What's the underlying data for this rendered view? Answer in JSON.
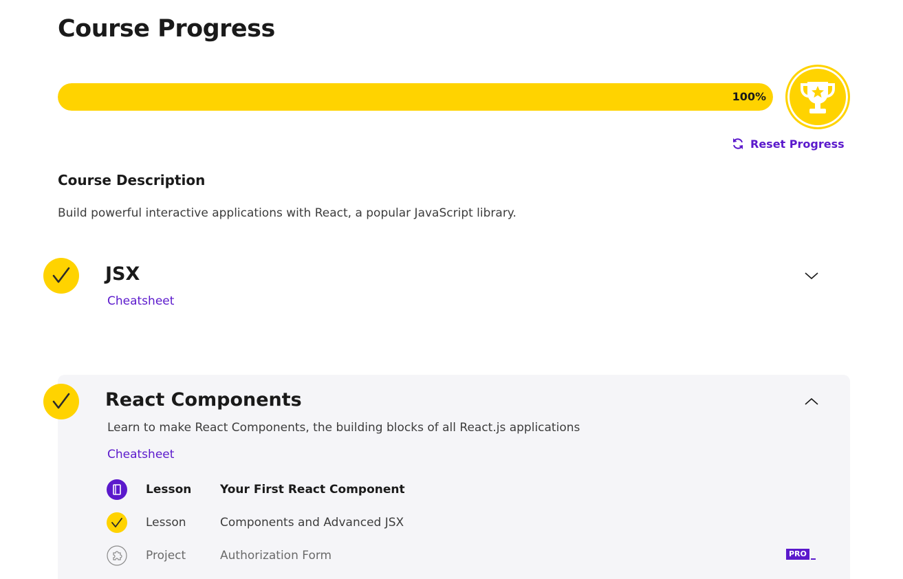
{
  "header": {
    "title": "Course Progress"
  },
  "progress": {
    "percent": 100,
    "label": "100%"
  },
  "colors": {
    "accent": "#ffd300",
    "link": "#5b19cc",
    "panel": "#f5f5f8"
  },
  "reset": {
    "label": "Reset Progress",
    "icon": "refresh-icon"
  },
  "description": {
    "heading": "Course Description",
    "text": "Build powerful interactive applications with React, a popular JavaScript library."
  },
  "modules": [
    {
      "title": "JSX",
      "cheatsheet": "Cheatsheet",
      "completed": true,
      "expanded": false
    },
    {
      "title": "React Components",
      "description": "Learn to make React Components, the building blocks of all React.js applications",
      "cheatsheet": "Cheatsheet",
      "completed": true,
      "expanded": true,
      "items": [
        {
          "type": "Lesson",
          "name": "Your First React Component",
          "icon": "book-icon",
          "current": true
        },
        {
          "type": "Lesson",
          "name": "Components and Advanced JSX",
          "icon": "check-icon",
          "current": false
        },
        {
          "type": "Project",
          "name": "Authorization Form",
          "icon": "puzzle-icon",
          "current": false,
          "badge": "PRO"
        }
      ]
    }
  ]
}
